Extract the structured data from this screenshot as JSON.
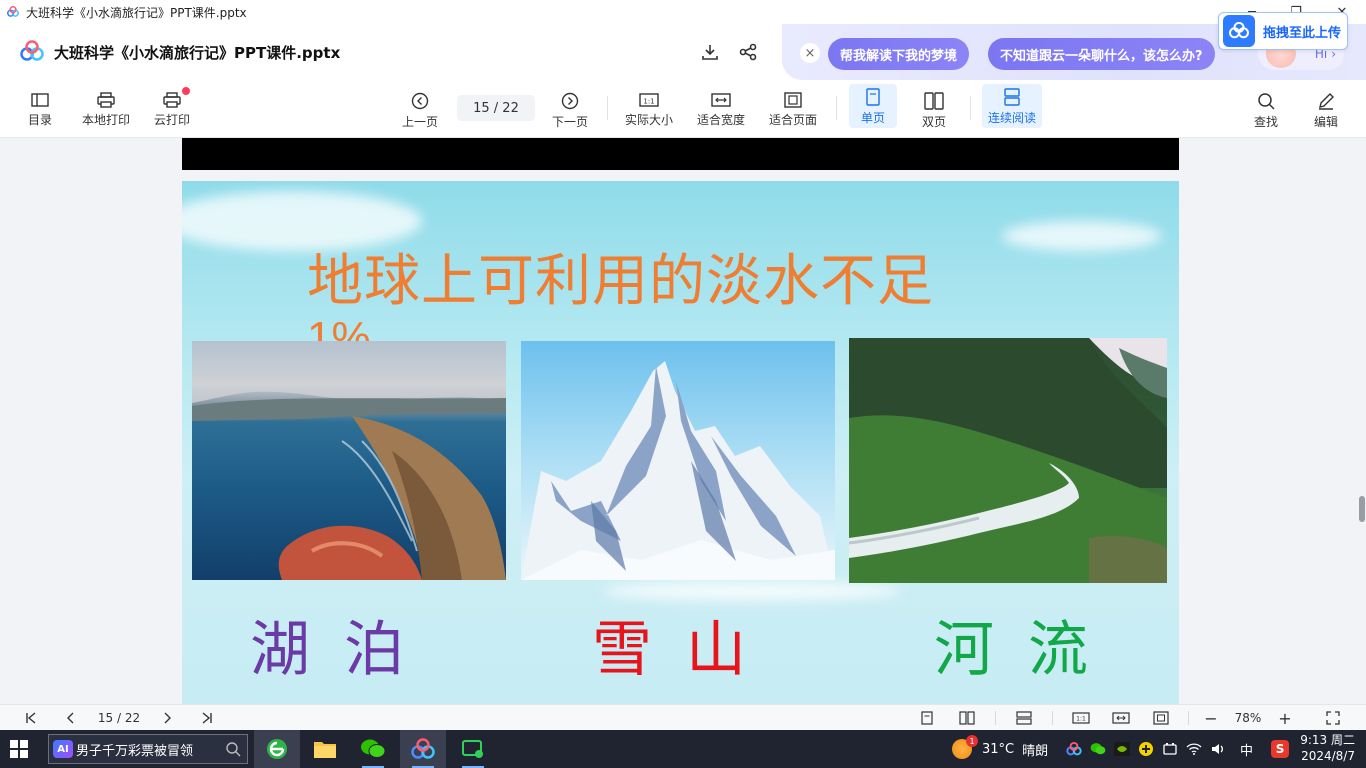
{
  "window": {
    "title": "大班科学《小水滴旅行记》PPT课件.pptx",
    "minimize": "─",
    "restore": "❐",
    "close": "✕"
  },
  "header": {
    "doc_title": "大班科学《小水滴旅行记》PPT课件.pptx"
  },
  "ai_panel": {
    "close": "×",
    "suggestions": [
      "帮我解读下我的梦境",
      "不知道跟云一朵聊什么，该怎么办?"
    ],
    "hi_label": "Hi",
    "upload_label": "拖拽至此上传"
  },
  "toolbar": {
    "toc": "目录",
    "local_print": "本地打印",
    "cloud_print": "云打印",
    "prev_page": "上一页",
    "page_indicator": "15 / 22",
    "next_page": "下一页",
    "actual_size": "实际大小",
    "fit_width": "适合宽度",
    "fit_page": "适合页面",
    "single_page": "单页",
    "double_page": "双页",
    "continuous": "连续阅读",
    "find": "查找",
    "edit": "编辑"
  },
  "slide": {
    "title_line1": "地球上可利用的淡水不足",
    "title_line2": "1%",
    "captions": [
      {
        "text": "湖泊",
        "color": "#6b3aa6"
      },
      {
        "text": "雪山",
        "color": "#e8141c"
      },
      {
        "text": "河流",
        "color": "#12a84a"
      }
    ]
  },
  "statusbar": {
    "page_indicator": "15 / 22",
    "zoom": "78%",
    "minus": "−",
    "plus": "+"
  },
  "taskbar": {
    "search_text": "男子千万彩票被冒领",
    "search_badge": "AI",
    "weather_temp": "31°C",
    "weather_desc": "晴朗",
    "weather_badge": "1",
    "ime": "中",
    "time": "9:13 周二",
    "date": "2024/8/7"
  }
}
